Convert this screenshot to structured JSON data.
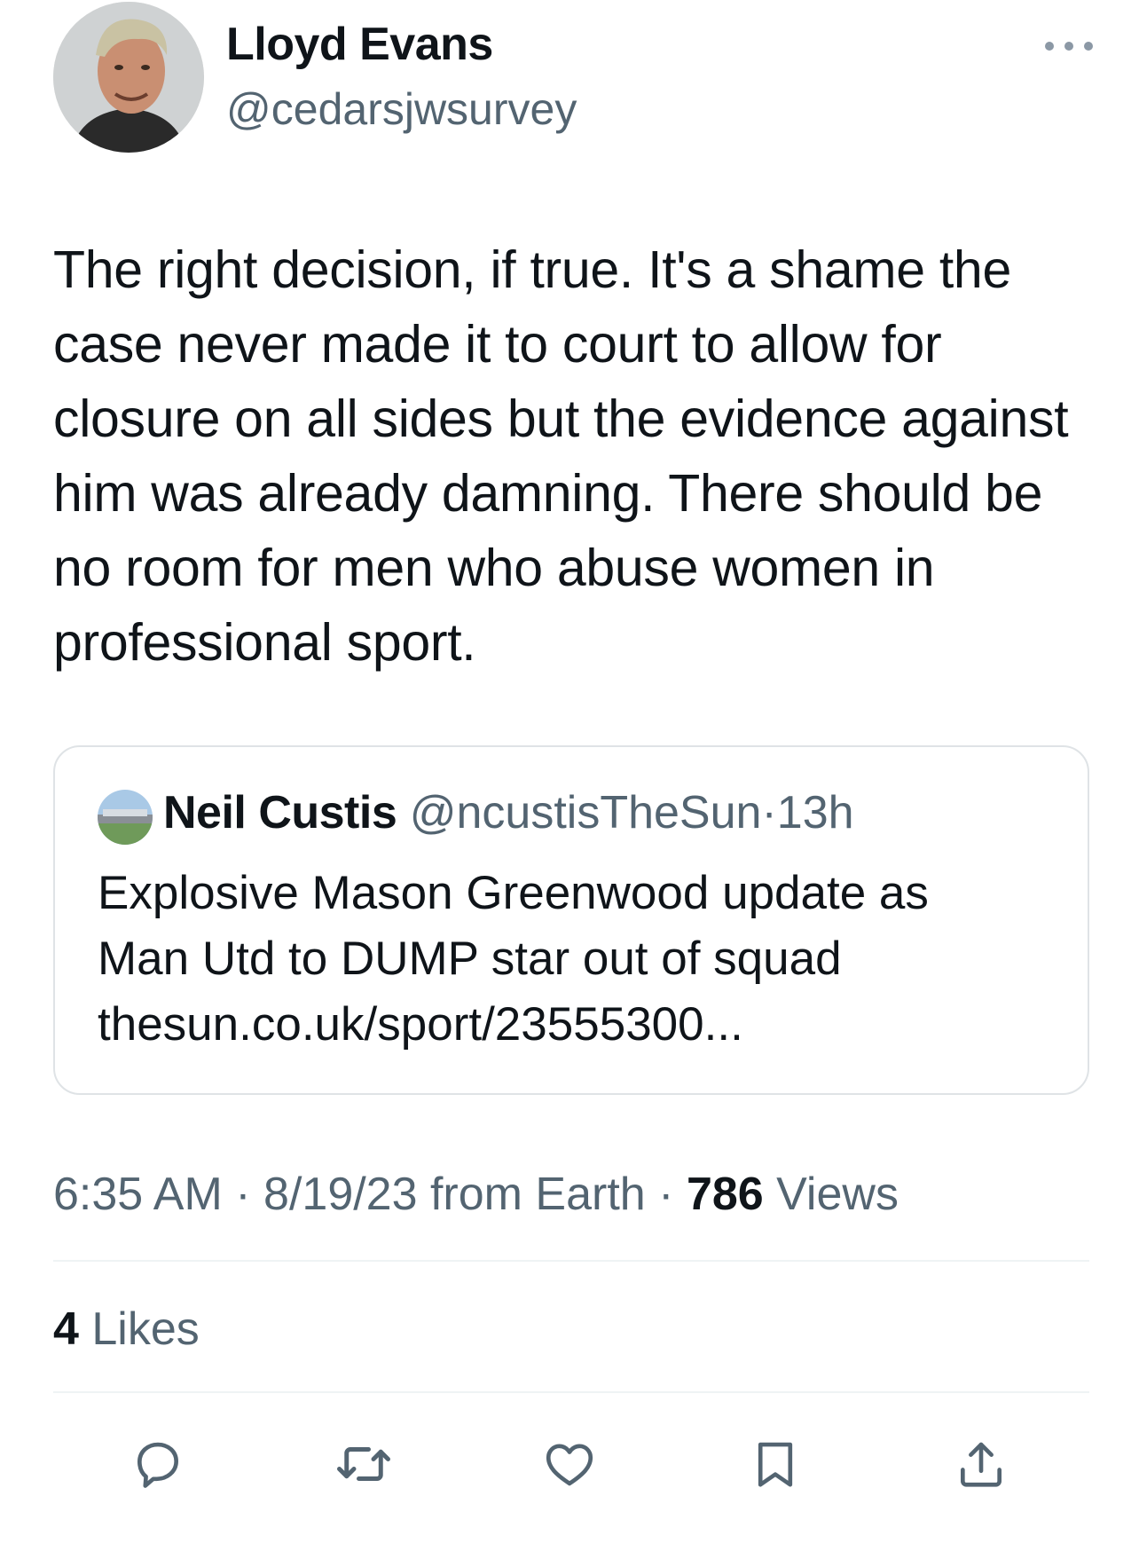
{
  "author": {
    "name": "Lloyd Evans",
    "handle": "@cedarsjwsurvey"
  },
  "tweet": {
    "text": "The right decision, if true. It's a shame the case never made it to court to allow for closure on all sides but the evidence against him was already damning. There should be no room for men who abuse women in professional sport."
  },
  "quoted": {
    "name": "Neil Custis",
    "handle": "@ncustisTheSun",
    "separator": "·",
    "time": "13h",
    "text_line1": "Explosive Mason Greenwood update as",
    "text_line2": "Man Utd to DUMP star out of squad",
    "link": "thesun.co.uk/sport/23555300..."
  },
  "meta": {
    "time": "6:35 AM",
    "sep1": "·",
    "date": "8/19/23",
    "source": "from Earth",
    "sep2": "·",
    "views_count": "786",
    "views_label": "Views"
  },
  "stats": {
    "likes_count": "4",
    "likes_label": "Likes"
  },
  "icons": {
    "more": "more-dots-icon",
    "reply": "reply-icon",
    "retweet": "retweet-icon",
    "like": "heart-icon",
    "bookmark": "bookmark-icon",
    "share": "share-icon"
  },
  "colors": {
    "text": "#0f1419",
    "secondary": "#536471",
    "border": "#dfe3e6"
  }
}
